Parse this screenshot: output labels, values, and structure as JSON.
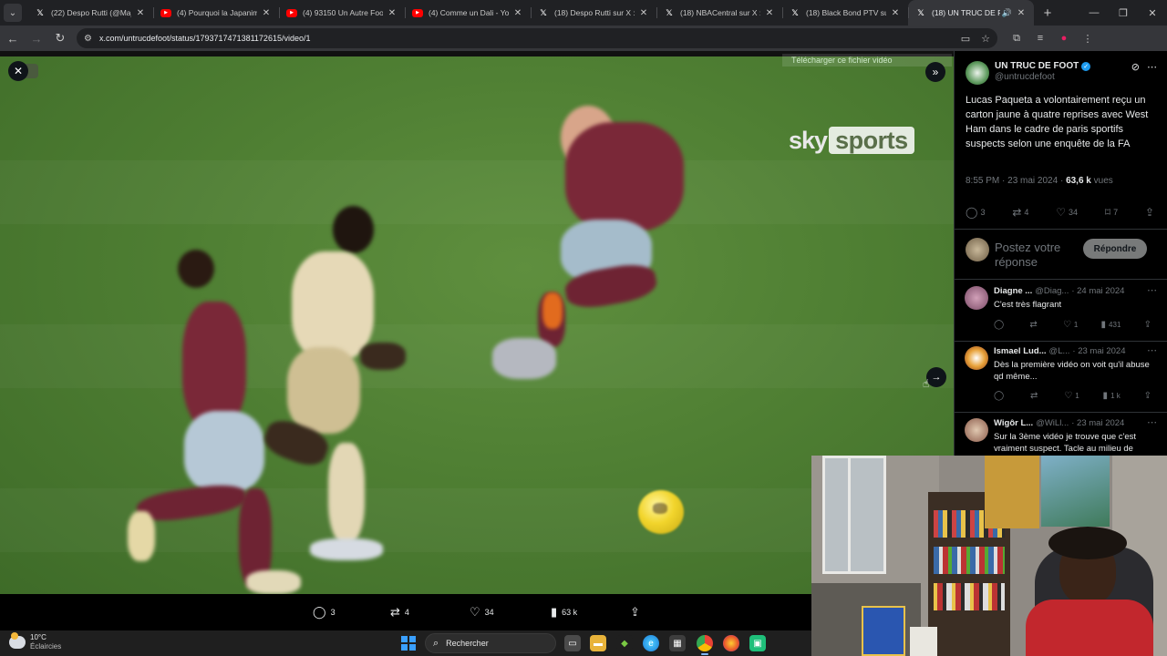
{
  "browser": {
    "tabs": [
      {
        "label": "(22) Despo Rutti (@Majst",
        "favicon": "x",
        "active": false
      },
      {
        "label": "(4) Pourquoi la Japanimati",
        "favicon": "youtube",
        "active": false
      },
      {
        "label": "(4) 93150 Un Autre Footh",
        "favicon": "youtube",
        "active": false
      },
      {
        "label": "(4) Comme un Dali - YouT",
        "favicon": "youtube",
        "active": false
      },
      {
        "label": "(18) Despo Rutti sur X : \"h",
        "favicon": "x",
        "active": false
      },
      {
        "label": "(18) NBACentral sur X : \"V",
        "favicon": "x",
        "active": false
      },
      {
        "label": "(18) Black Bond PTV sur X",
        "favicon": "x",
        "active": false
      },
      {
        "label": "(18) UN TRUC DE FOO",
        "favicon": "x",
        "active": true
      }
    ],
    "url": "x.com/untrucdefoot/status/1793717471381172615/video/1"
  },
  "video": {
    "watermark": "sky",
    "watermark_box": "sports",
    "download_label": "Télécharger ce fichier vidéo",
    "stats": {
      "replies": "3",
      "reposts": "4",
      "likes": "34",
      "views": "63 k"
    }
  },
  "tweet": {
    "author_name": "UN TRUC DE FOOT",
    "author_handle": "@untrucdefoot",
    "text": "Lucas Paqueta a volontairement reçu un carton jaune à quatre reprises avec West Ham dans le cadre de paris sportifs suspects selon une enquête de la FA",
    "time": "8:55 PM · 23 mai 2024 · ",
    "views_count": "63,6 k",
    "views_label": " vues",
    "actions": {
      "replies": "3",
      "reposts": "4",
      "likes": "34",
      "bookmarks": "7"
    },
    "reply_placeholder": "Postez votre réponse",
    "reply_button": "Répondre"
  },
  "comments": [
    {
      "name": "Diagne ...",
      "handle": "@Diag...",
      "date": "· 24 mai 2024",
      "text": "C'est très flagrant",
      "likes": "1",
      "views": "431"
    },
    {
      "name": "Ismael Lud...",
      "handle": "@L...",
      "date": "· 23 mai 2024",
      "text": "Dès la première vidéo on voit qu'il abuse qd même...",
      "likes": "1",
      "views": "1 k"
    },
    {
      "name": "Wigôr L...",
      "handle": "@WiLl...",
      "date": "· 23 mai 2024",
      "text": "Sur la 3ème vidéo je trouve que c'est vraiment suspect. Tacle au milieu de"
    }
  ],
  "taskbar": {
    "temperature": "10°C",
    "condition": "Éclaircies",
    "search_label": "Rechercher"
  },
  "colors": {
    "accent": "#1d9bf0",
    "background": "#000000",
    "pitch": "#4f7f33"
  }
}
